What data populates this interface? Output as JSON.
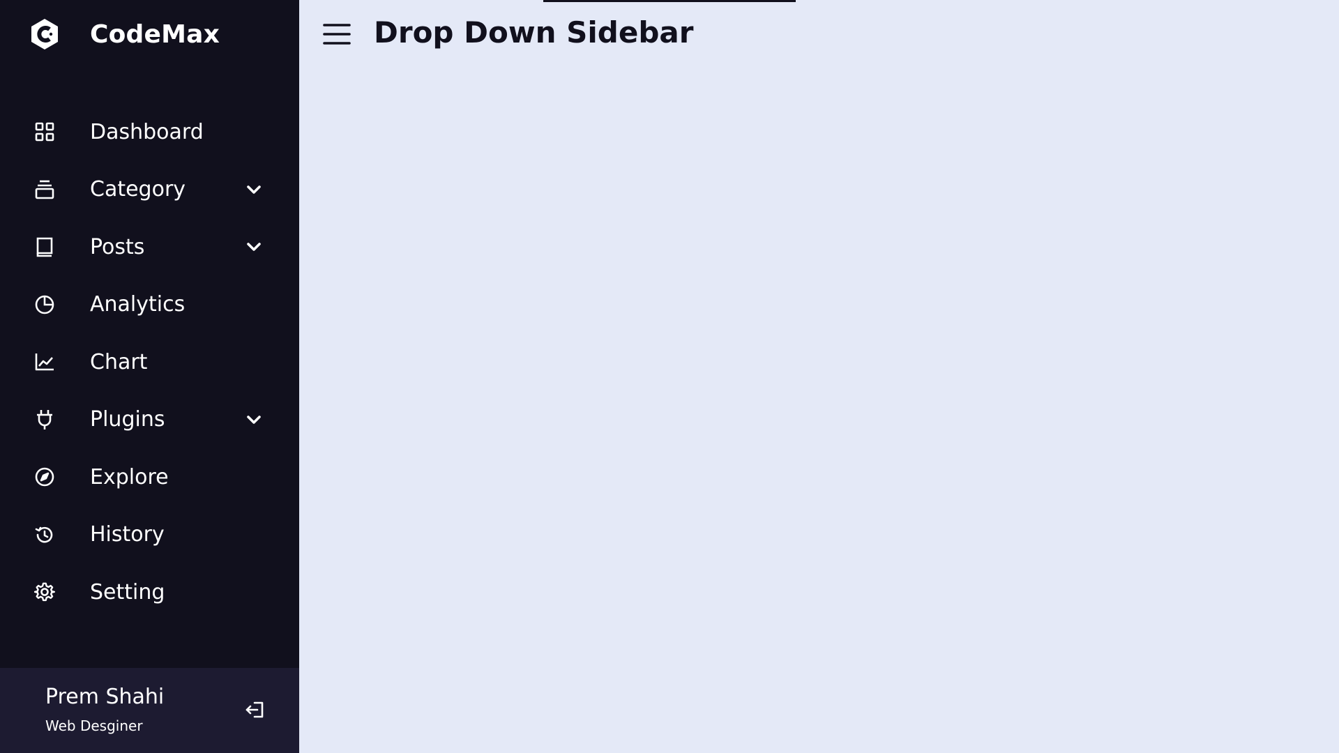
{
  "brand": {
    "name": "CodeMax",
    "icon": "codemax-logo-icon"
  },
  "header": {
    "title": "Drop Down Sidebar",
    "menu_icon": "hamburger-menu-icon"
  },
  "sidebar": {
    "items": [
      {
        "label": "Dashboard",
        "icon": "grid-icon",
        "has_dropdown": false
      },
      {
        "label": "Category",
        "icon": "collection-icon",
        "has_dropdown": true
      },
      {
        "label": "Posts",
        "icon": "book-icon",
        "has_dropdown": true
      },
      {
        "label": "Analytics",
        "icon": "pie-chart-icon",
        "has_dropdown": false
      },
      {
        "label": "Chart",
        "icon": "line-chart-icon",
        "has_dropdown": false
      },
      {
        "label": "Plugins",
        "icon": "plug-icon",
        "has_dropdown": true
      },
      {
        "label": "Explore",
        "icon": "compass-icon",
        "has_dropdown": false
      },
      {
        "label": "History",
        "icon": "history-icon",
        "has_dropdown": false
      },
      {
        "label": "Setting",
        "icon": "gear-icon",
        "has_dropdown": false
      }
    ]
  },
  "profile": {
    "name": "Prem Shahi",
    "job": "Web Desginer",
    "logout_icon": "logout-icon"
  },
  "colors": {
    "sidebar_bg": "#11101d",
    "profile_bg": "#1d1b31",
    "content_bg": "#e4e9f7",
    "text_light": "#ffffff",
    "text_dark": "#11101d"
  }
}
